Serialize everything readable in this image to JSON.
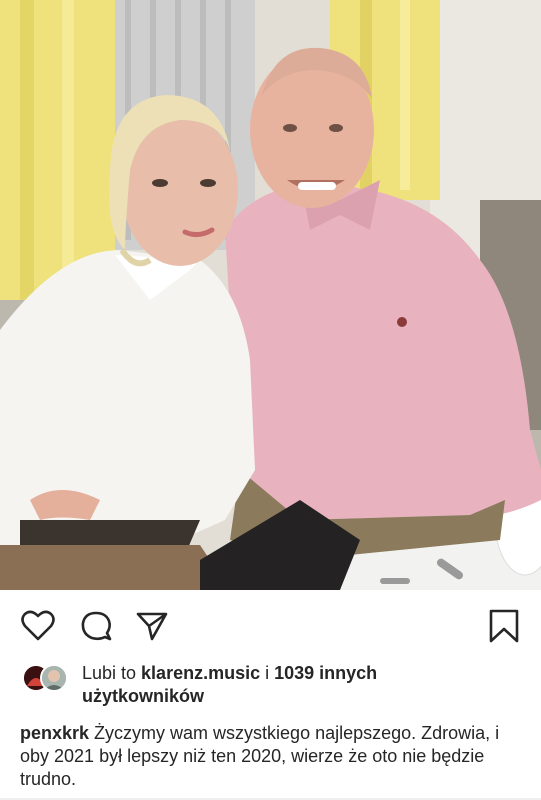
{
  "post": {
    "photo": {
      "alt_icon": "photo-of-couple",
      "colors": {
        "curtain": "#efe47a",
        "wall": "#e8e4dc",
        "pink_shirt": "#e6b0bd",
        "white_shirt": "#f4f3f0",
        "skin": "#e7b7a1"
      }
    },
    "actions": {
      "like_icon": "heart-icon",
      "comment_icon": "comment-icon",
      "share_icon": "paper-plane-icon",
      "save_icon": "bookmark-icon"
    },
    "likes": {
      "prefix": "Lubi to ",
      "user": "klarenz.music",
      "middle": " i ",
      "count": "1039 innych",
      "line2": "użytkowników"
    },
    "caption": {
      "username": "penxkrk",
      "text": " Życzymy wam wszystkiego najlepszego. Zdrowia, i oby 2021 był lepszy niż ten 2020, wierze że oto nie będzie trudno."
    }
  }
}
